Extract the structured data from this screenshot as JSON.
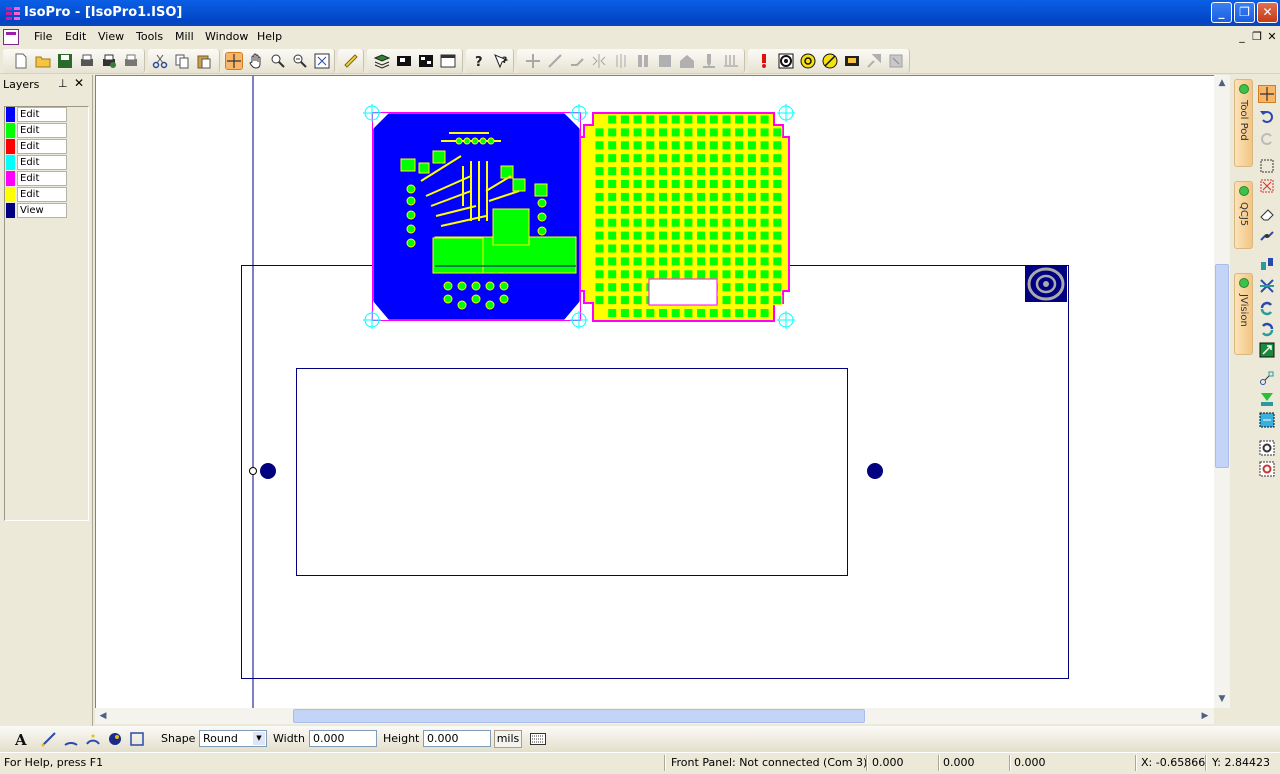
{
  "window": {
    "title": "IsoPro - [IsoPro1.ISO]"
  },
  "menu": {
    "items": [
      "File",
      "Edit",
      "View",
      "Tools",
      "Mill",
      "Window",
      "Help"
    ]
  },
  "layers": {
    "title": "Layers",
    "items": [
      {
        "label": "Edit",
        "color": "#0000ff"
      },
      {
        "label": "Edit",
        "color": "#00ff00"
      },
      {
        "label": "Edit",
        "color": "#ff0000"
      },
      {
        "label": "Edit",
        "color": "#00ffff"
      },
      {
        "label": "Edit",
        "color": "#ff00ff"
      },
      {
        "label": "Edit",
        "color": "#ffff00"
      },
      {
        "label": "View",
        "color": "#000080"
      }
    ]
  },
  "side_tabs": [
    "Tool Pod",
    "QCJ5",
    "JVision"
  ],
  "shape_bar": {
    "shape_label": "Shape",
    "shape_value": "Round",
    "width_label": "Width",
    "width_value": "0.000",
    "height_label": "Height",
    "height_value": "0.000",
    "units_button": "mils"
  },
  "status": {
    "help": "For Help, press F1",
    "front_panel": "Front Panel: Not connected (Com 3)",
    "val1": "0.000",
    "val2": "0.000",
    "val3": "0.000",
    "x": "X: -0.65866",
    "y": "Y: 2.84423"
  },
  "colors": {
    "board_blue": "#0000ff",
    "pad_green": "#00ff00",
    "trace_yellow": "#ffff00",
    "outline_magenta": "#ff00ff",
    "outline_navy": "#000080",
    "fiducial_cyan": "#00ffff"
  }
}
